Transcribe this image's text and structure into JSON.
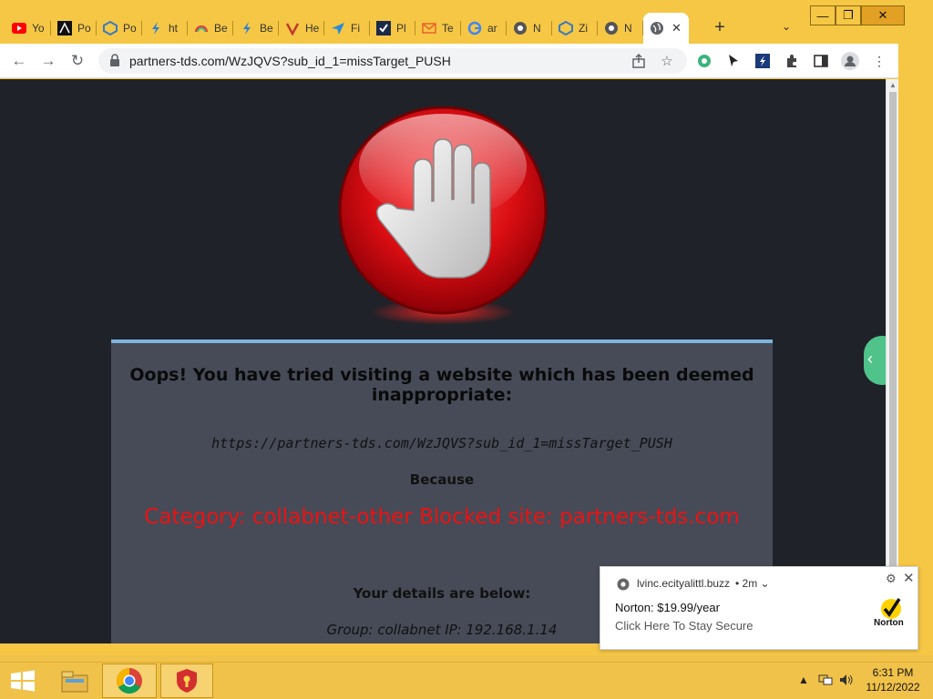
{
  "browser": {
    "tabs": [
      {
        "label": "Yo",
        "icon": "youtube-icon"
      },
      {
        "label": "Po",
        "icon": "app-icon"
      },
      {
        "label": "Po",
        "icon": "shield-icon"
      },
      {
        "label": "ht",
        "icon": "bolt-icon"
      },
      {
        "label": "Be",
        "icon": "rainbow-icon"
      },
      {
        "label": "Be",
        "icon": "bolt-icon"
      },
      {
        "label": "He",
        "icon": "v-icon"
      },
      {
        "label": "Fi",
        "icon": "plane-icon"
      },
      {
        "label": "Pl",
        "icon": "check-icon"
      },
      {
        "label": "Te",
        "icon": "mail-icon"
      },
      {
        "label": "ar",
        "icon": "google-icon"
      },
      {
        "label": "N",
        "icon": "chrome-icon"
      },
      {
        "label": "Zi",
        "icon": "shield-icon"
      },
      {
        "label": "N",
        "icon": "chrome-icon"
      }
    ],
    "active_tab": {
      "icon": "globe-icon",
      "close": "✕"
    },
    "new_tab": "+",
    "address": "partners-tds.com/WzJQVS?sub_id_1=missTarget_PUSH",
    "window_controls": {
      "minimize": "—",
      "maximize": "❐",
      "close": "✕"
    }
  },
  "block_page": {
    "heading": "Oops! You have tried visiting a website which has been deemed inappropriate:",
    "url": "https://partners-tds.com/WzJQVS?sub_id_1=missTarget_PUSH",
    "because": "Because",
    "category": "Category: collabnet-other  Blocked site: partners-tds.com",
    "details_heading": "Your details are below:",
    "details": "Group: collabnet    IP: 192.168.1.14"
  },
  "notification": {
    "domain": "lvinc.ecityalittl.buzz",
    "age": "• 2m ⌄",
    "title": "Norton: $19.99/year",
    "body": "Click Here To Stay Secure",
    "logo_text": "Norton"
  },
  "taskbar": {
    "time": "6:31 PM",
    "date": "11/12/2022"
  },
  "colors": {
    "frame": "#f5c744",
    "page_bg": "#1f2228",
    "card_bg": "#464b57",
    "category_red": "#ee1111",
    "side_handle": "#4fc38a"
  }
}
